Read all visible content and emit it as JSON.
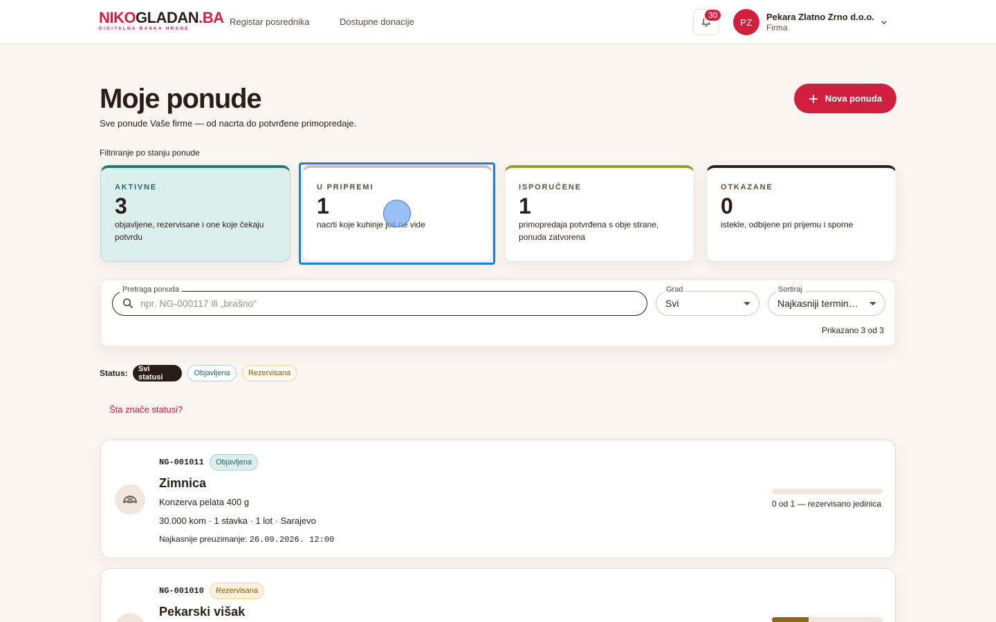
{
  "header": {
    "logo": {
      "part1": "NIKO",
      "part2": "GLADAN",
      "part3": ".BA",
      "tagline": "DIGITALNA BANKA HRANE"
    },
    "nav": [
      {
        "label": "Registar posrednika"
      },
      {
        "label": "Dostupne donacije"
      }
    ],
    "notifications_count": "30",
    "user": {
      "initials": "PZ",
      "name": "Pekara Zlatno Zrno d.o.o.",
      "role": "Firma"
    }
  },
  "page": {
    "title": "Moje ponude",
    "subtitle": "Sve ponude Vaše firme — od nacrta do potvrđene primopredaje.",
    "new_button": "Nova ponuda",
    "filter_label": "Filtriranje po stanju ponude"
  },
  "stats": [
    {
      "kicker": "AKTIVNE",
      "count": "3",
      "desc": "objavljene, rezervisane i one koje čekaju potvrdu"
    },
    {
      "kicker": "U PRIPREMI",
      "count": "1",
      "desc": "nacrti koje kuhinje još ne vide"
    },
    {
      "kicker": "ISPORUČENE",
      "count": "1",
      "desc": "primopredaja potvrđena s obje strane, ponuda zatvorena"
    },
    {
      "kicker": "OTKAZANE",
      "count": "0",
      "desc": "istekle, odbijene pri prijemu i sporne"
    }
  ],
  "search": {
    "label": "Pretraga ponuda",
    "placeholder": "npr. NG-000117 ili „brašno\"",
    "value": "",
    "city_label": "Grad",
    "city_value": "Svi",
    "sort_label": "Sortiraj",
    "sort_value": "Najkasniji termin preuzimanja",
    "shown": "Prikazano 3 od 3"
  },
  "status_filter": {
    "label": "Status:",
    "chips": [
      "Svi statusi",
      "Objavljena",
      "Rezervisana"
    ],
    "help": "Šta znače statusi?"
  },
  "offers": [
    {
      "code": "NG-001011",
      "badge": "Objavljena",
      "title": "Zimnica",
      "product": "Konzerva pelata 400 g",
      "meta": "30.000 kom · 1 stavka · 1 lot · Sarajevo",
      "deadline_label": "Najkasnije preuzimanje: ",
      "deadline": "26.09.2026. 12:00",
      "progress_fraction": 0,
      "progress_text": "0 od 1 — rezervisano jedinica",
      "icon": "croissant-icon"
    },
    {
      "code": "NG-001010",
      "badge": "Rezervisana",
      "title": "Pekarski višak",
      "progress_fraction": 0.33,
      "icon": "bread-icon"
    }
  ],
  "colors": {
    "brand": "#d11f3f",
    "active": "#1f7a73",
    "delivered": "#8ba12a",
    "cancelled": "#2a1d17",
    "focus": "#1e7be0"
  }
}
